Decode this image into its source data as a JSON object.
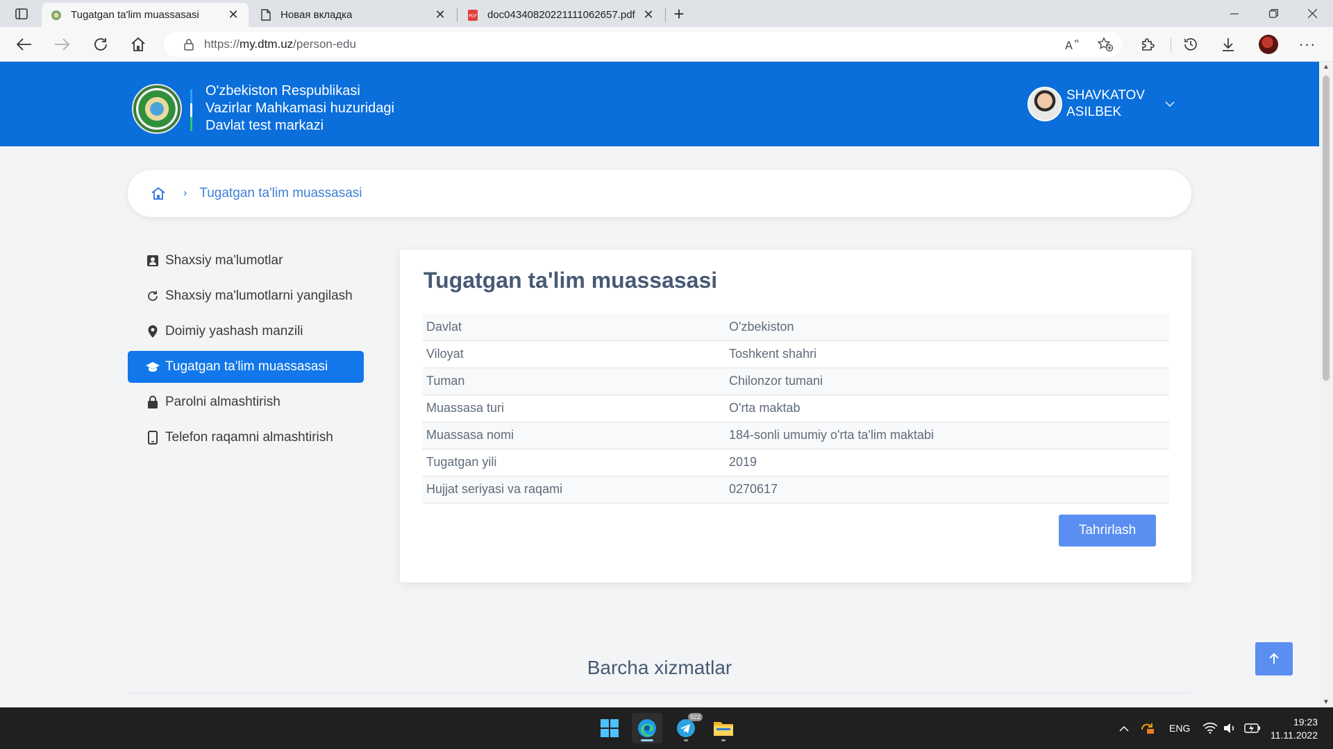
{
  "browser": {
    "tabs": [
      {
        "title": "Tugatgan ta'lim muassasasi",
        "active": true
      },
      {
        "title": "Новая вкладка",
        "active": false
      },
      {
        "title": "doc04340820221111062657.pdf",
        "active": false
      }
    ],
    "url_prefix": "https://",
    "url_domain": "my.dtm.uz",
    "url_path": "/person-edu"
  },
  "header": {
    "org_line1": "O'zbekiston Respublikasi",
    "org_line2": "Vazirlar Mahkamasi huzuridagi",
    "org_line3": "Davlat test markazi",
    "user_last": "SHAVKATOV",
    "user_first": "ASILBEK"
  },
  "breadcrumb": {
    "current": "Tugatgan ta'lim muassasasi"
  },
  "sidebar": {
    "items": [
      {
        "label": "Shaxsiy ma'lumotlar",
        "icon": "user-card-icon"
      },
      {
        "label": "Shaxsiy ma'lumotlarni yangilash",
        "icon": "refresh-icon"
      },
      {
        "label": "Doimiy yashash manzili",
        "icon": "map-pin-icon"
      },
      {
        "label": "Tugatgan ta'lim muassasasi",
        "icon": "graduation-cap-icon",
        "active": true
      },
      {
        "label": "Parolni almashtirish",
        "icon": "lock-icon"
      },
      {
        "label": "Telefon raqamni almashtirish",
        "icon": "phone-icon"
      }
    ]
  },
  "card": {
    "title": "Tugatgan ta'lim muassasasi",
    "rows": [
      {
        "key": "Davlat",
        "value": "O'zbekiston"
      },
      {
        "key": "Viloyat",
        "value": "Toshkent shahri"
      },
      {
        "key": "Tuman",
        "value": "Chilonzor tumani"
      },
      {
        "key": "Muassasa turi",
        "value": "O'rta maktab"
      },
      {
        "key": "Muassasa nomi",
        "value": "184-sonli umumiy o'rta ta'lim maktabi"
      },
      {
        "key": "Tugatgan yili",
        "value": "2019"
      },
      {
        "key": "Hujjat seriyasi va raqami",
        "value": "0270617"
      }
    ],
    "edit_label": "Tahrirlash"
  },
  "services": {
    "title": "Barcha xizmatlar"
  },
  "taskbar": {
    "telegram_badge": "922",
    "lang": "ENG",
    "time": "19:23",
    "date": "11.11.2022"
  },
  "colors": {
    "header_blue": "#0a6edb",
    "active_nav": "#1277ea",
    "button_blue": "#5a8ef0"
  }
}
